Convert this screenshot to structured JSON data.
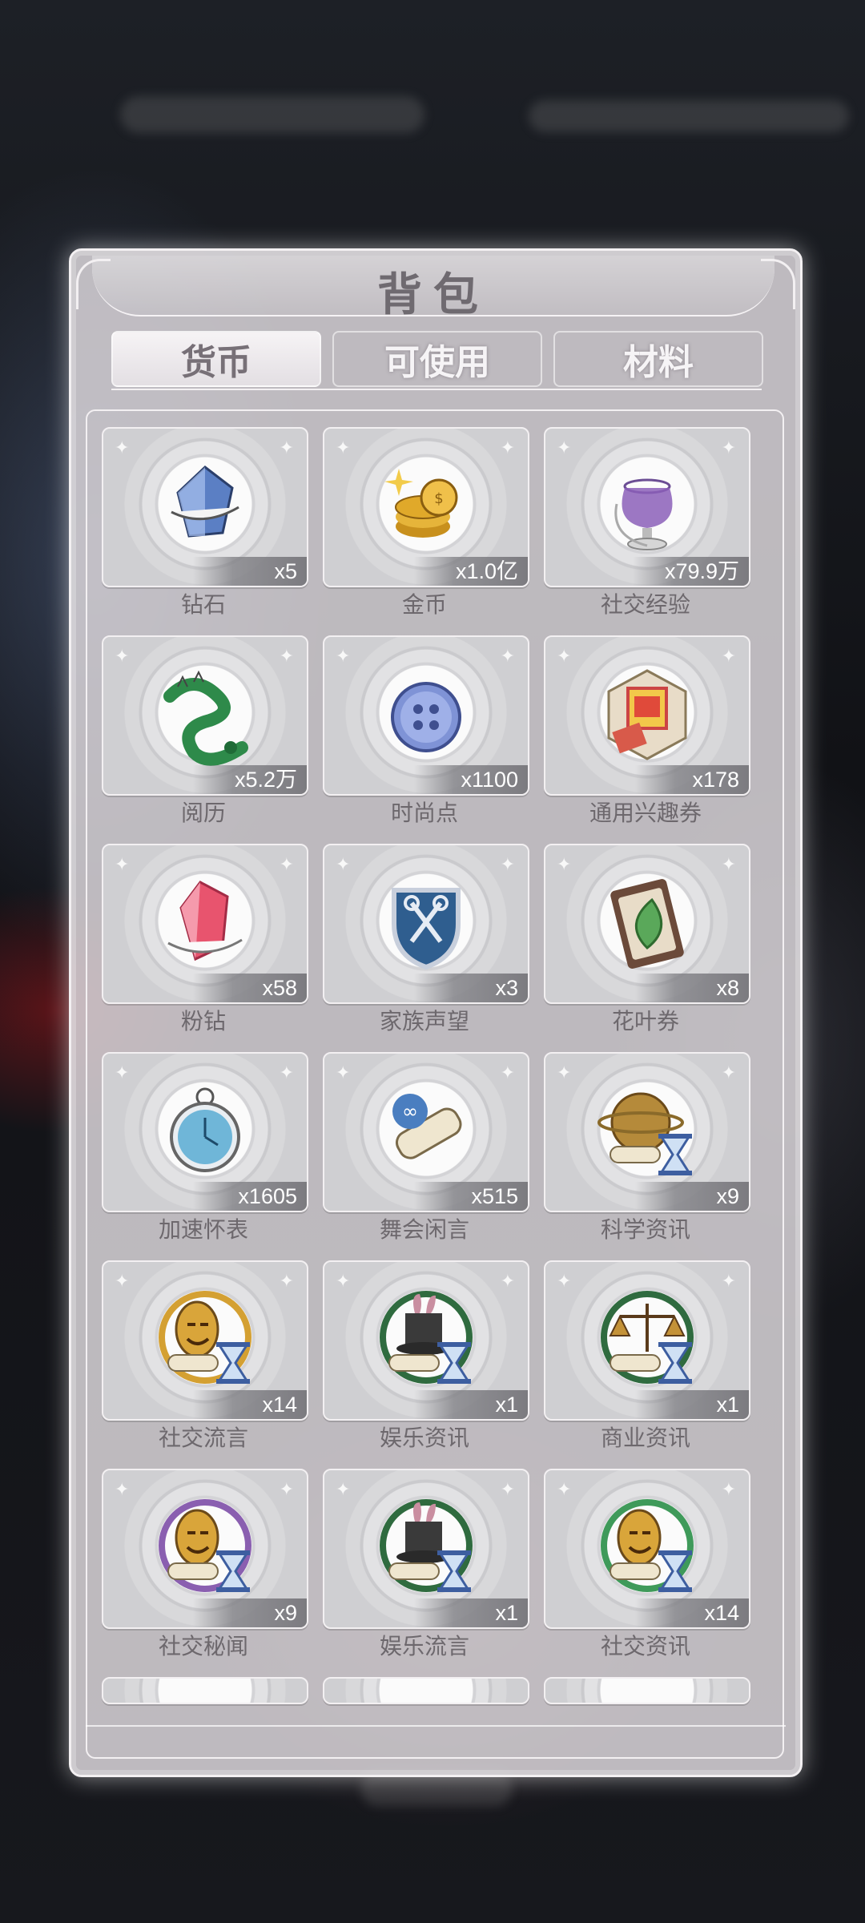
{
  "title": "背包",
  "tabs": [
    {
      "label": "货币",
      "active": true
    },
    {
      "label": "可使用",
      "active": false
    },
    {
      "label": "材料",
      "active": false
    }
  ],
  "items": [
    {
      "name": "钻石",
      "count": "x5",
      "icon": "diamond-crystal-icon",
      "color": "#5b7fc4"
    },
    {
      "name": "金币",
      "count": "x1.0亿",
      "icon": "gold-coins-icon",
      "color": "#e0a92a"
    },
    {
      "name": "社交经验",
      "count": "x79.9万",
      "icon": "purple-glass-globe-icon",
      "color": "#8b5fb8"
    },
    {
      "name": "阅历",
      "count": "x5.2万",
      "icon": "green-serpent-icon",
      "color": "#2e8a4a"
    },
    {
      "name": "时尚点",
      "count": "x1100",
      "icon": "blue-button-icon",
      "color": "#7f93d6"
    },
    {
      "name": "通用兴趣券",
      "count": "x178",
      "icon": "stamp-ticket-icon",
      "color": "#d85a4a"
    },
    {
      "name": "粉钻",
      "count": "x58",
      "icon": "pink-crystal-icon",
      "color": "#e8546e"
    },
    {
      "name": "家族声望",
      "count": "x3",
      "icon": "shield-keys-icon",
      "color": "#2f5e8f"
    },
    {
      "name": "花叶券",
      "count": "x8",
      "icon": "leaf-card-icon",
      "color": "#6b4a3a"
    },
    {
      "name": "加速怀表",
      "count": "x1605",
      "icon": "pocket-watch-icon",
      "color": "#6fb6d8"
    },
    {
      "name": "舞会闲言",
      "count": "x515",
      "icon": "scroll-infinity-icon",
      "color": "#4a7ec0"
    },
    {
      "name": "科学资讯",
      "count": "x9",
      "icon": "globe-scroll-hourglass-icon",
      "color": "#b58a3a"
    },
    {
      "name": "社交流言",
      "count": "x14",
      "icon": "mask-scroll-hourglass-icon",
      "color": "#d4a032"
    },
    {
      "name": "娱乐资讯",
      "count": "x1",
      "icon": "magic-hat-scroll-hourglass-icon",
      "color": "#c98ea0"
    },
    {
      "name": "商业资讯",
      "count": "x1",
      "icon": "scales-scroll-hourglass-icon",
      "color": "#c49238"
    },
    {
      "name": "社交秘闻",
      "count": "x9",
      "icon": "mask-scroll-hourglass-purple-icon",
      "color": "#8a5fb0"
    },
    {
      "name": "娱乐流言",
      "count": "x1",
      "icon": "magic-hat-scroll-hourglass-icon",
      "color": "#c98ea0"
    },
    {
      "name": "社交资讯",
      "count": "x14",
      "icon": "mask-scroll-hourglass-green-icon",
      "color": "#3f9a5a"
    }
  ],
  "colors": {
    "panel": "#dad5da",
    "tab_text_active": "#777077",
    "label_text": "#6d686d"
  }
}
